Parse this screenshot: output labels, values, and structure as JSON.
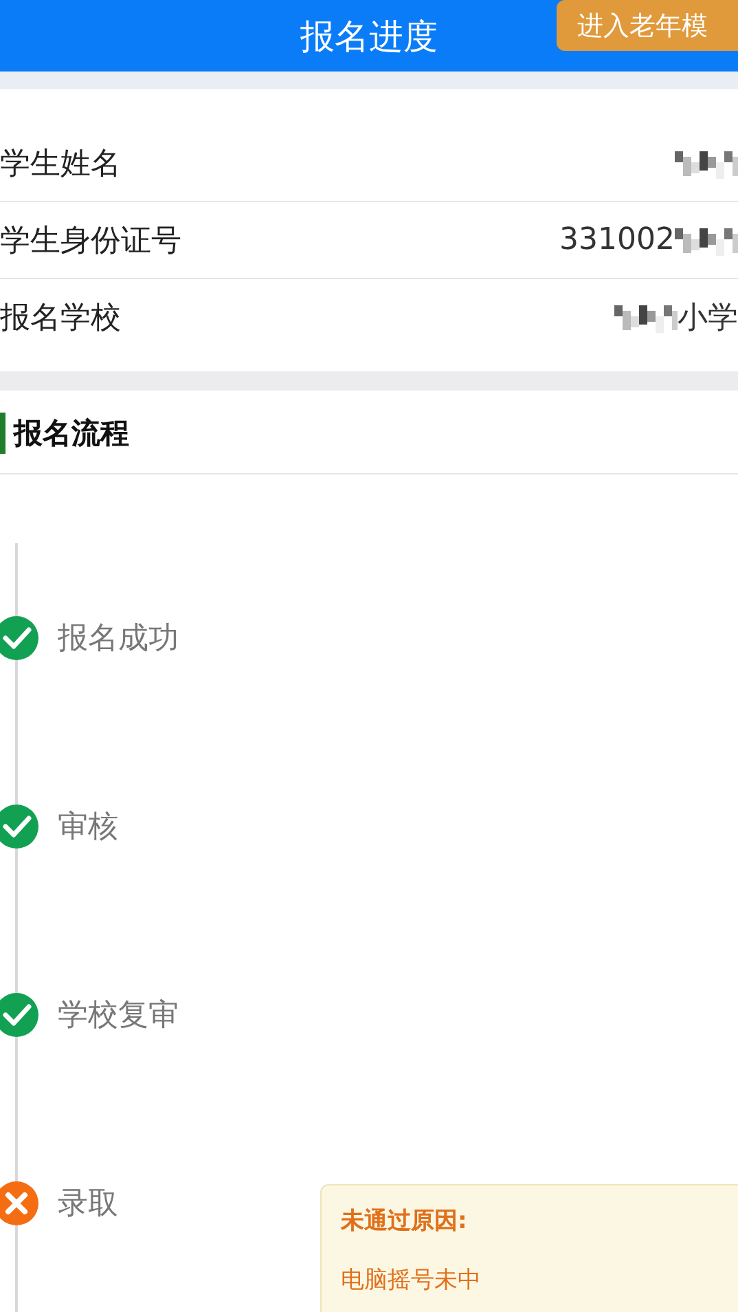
{
  "header": {
    "title": "报名进度",
    "elder_mode_button": "进入老年模"
  },
  "info": [
    {
      "label": "学生姓名",
      "redacted": true
    },
    {
      "label": "学生身份证号",
      "value": "331002",
      "redacted": true,
      "kind": "tail"
    },
    {
      "label": "报名学校",
      "value": "小学",
      "redacted": true,
      "kind": "head"
    }
  ],
  "process": {
    "title": "报名流程",
    "steps": [
      {
        "label": "报名成功",
        "kind": "passed"
      },
      {
        "label": "审核",
        "kind": "passed"
      },
      {
        "label": "学校复审",
        "kind": "passed"
      },
      {
        "label": "录取",
        "kind": "failed",
        "reason": {
          "title": "未通过原因:",
          "text": "电脑摇号未中"
        }
      }
    ]
  }
}
